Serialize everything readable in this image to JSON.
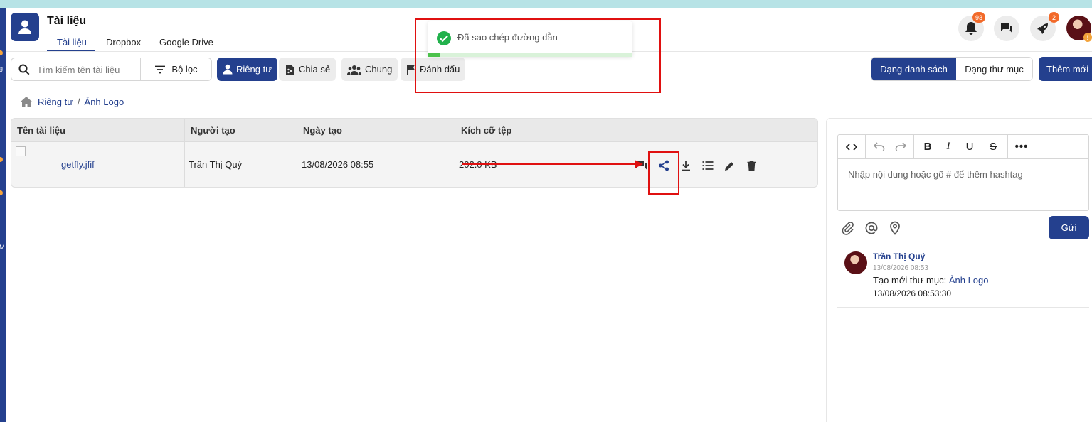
{
  "app": {
    "title": "Tài liệu",
    "tabs": [
      {
        "label": "Tài liệu",
        "active": true
      },
      {
        "label": "Dropbox",
        "active": false
      },
      {
        "label": "Google Drive",
        "active": false
      }
    ]
  },
  "header": {
    "notifications_count": "93",
    "rocket_count": "2"
  },
  "sidebar_edge": {
    "letters": [
      "g",
      "M"
    ]
  },
  "toolbar": {
    "search_placeholder": "Tìm kiếm tên tài liệu",
    "filter_label": "Bộ lọc",
    "chips": [
      {
        "label": "Riêng tư",
        "icon": "person-icon",
        "active": true
      },
      {
        "label": "Chia sẻ",
        "icon": "shared-doc-icon",
        "active": false
      },
      {
        "label": "Chung",
        "icon": "group-icon",
        "active": false
      },
      {
        "label": "Đánh dấu",
        "icon": "flag-icon",
        "active": false
      }
    ],
    "view_list": "Dạng danh sách",
    "view_folder": "Dạng thư mục",
    "add_new": "Thêm mới"
  },
  "breadcrumb": {
    "items": [
      "Riêng tư",
      "Ảnh Logo"
    ],
    "separator": "/"
  },
  "table": {
    "columns": [
      "Tên tài liệu",
      "Người tạo",
      "Ngày tạo",
      "Kích cỡ tệp"
    ],
    "rows": [
      {
        "name": "getfly.jfif",
        "creator": "Trần Thị Quý",
        "created": "13/08/2026 08:55",
        "size": "202.0 KB"
      }
    ],
    "row_actions": [
      "comment-icon",
      "share-icon",
      "download-icon",
      "list-icon",
      "edit-icon",
      "delete-icon"
    ]
  },
  "comment_panel": {
    "placeholder": "Nhập nội dung hoặc gõ # để thêm hashtag",
    "toolbar": [
      "code-icon",
      "undo-icon",
      "redo-icon",
      "bold-icon",
      "italic-icon",
      "underline-icon",
      "strikethrough-icon",
      "more-icon"
    ],
    "send_label": "Gửi",
    "activity": {
      "author": "Trần Thị Quý",
      "time": "13/08/2026 08:53",
      "text_prefix": "Tạo mới thư mục:",
      "text_link": "Ảnh Logo",
      "stamp": "13/08/2026 08:53:30"
    }
  },
  "toast": {
    "message": "Đã sao chép đường dẫn",
    "progress": 0.06
  },
  "colors": {
    "primary": "#24408e",
    "badge": "#f26a2a",
    "success": "#4cc24c",
    "annotation": "#e01010"
  }
}
